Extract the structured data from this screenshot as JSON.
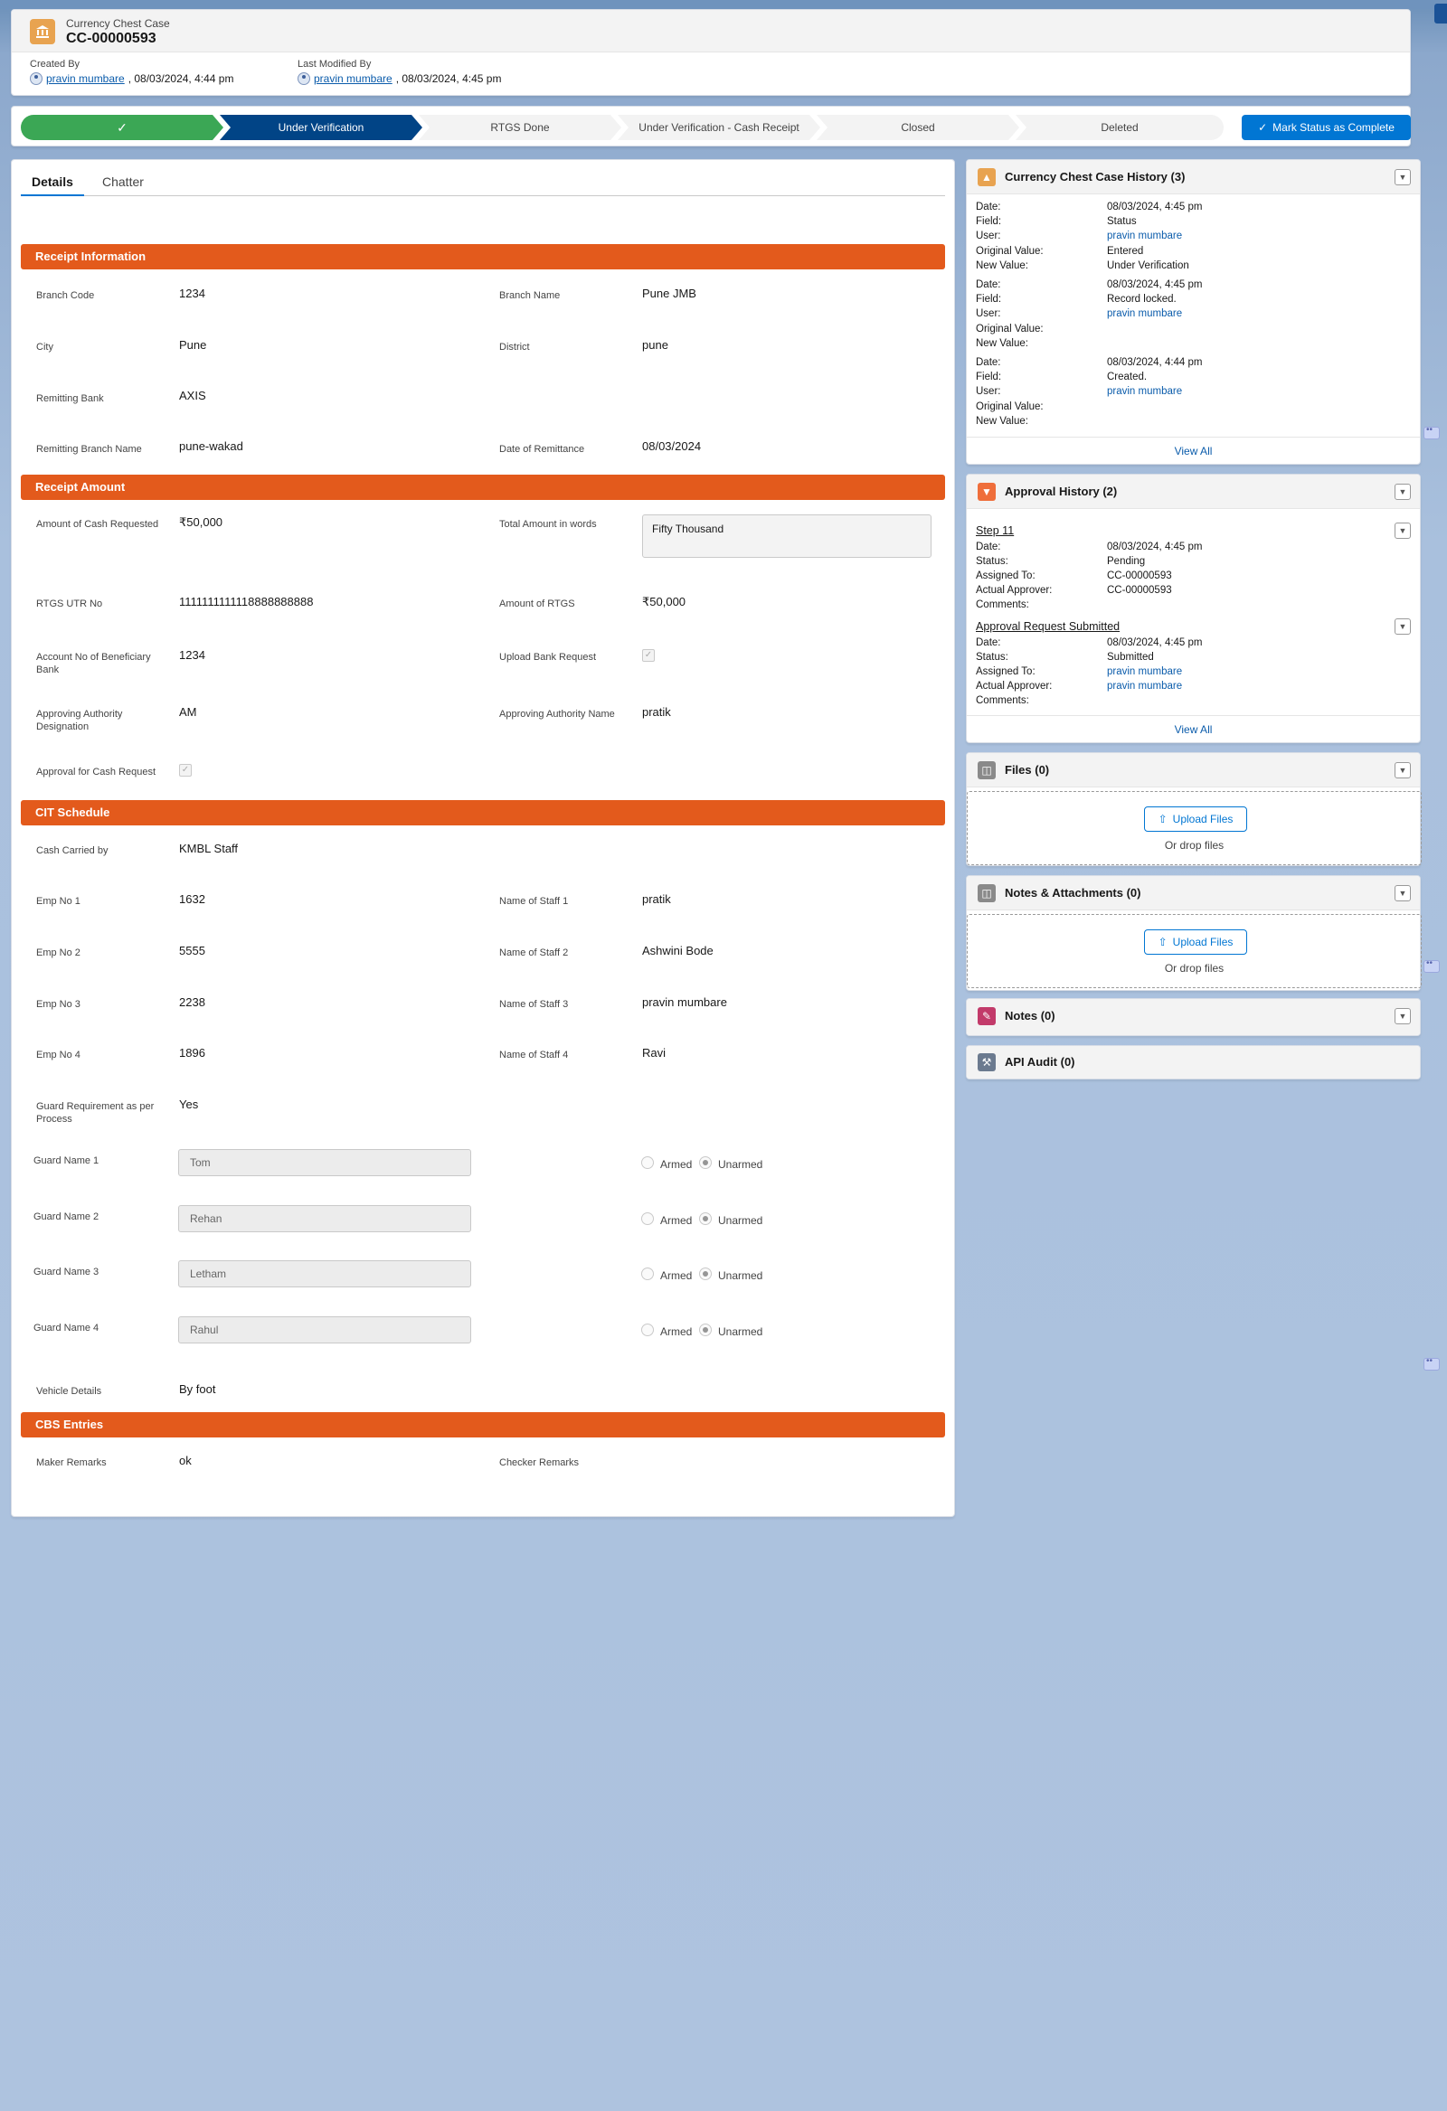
{
  "header": {
    "object_label": "Currency Chest Case",
    "record_name": "CC-00000593",
    "created_by_label": "Created By",
    "created_by_user": "pravin mumbare",
    "created_by_date": ", 08/03/2024, 4:44 pm",
    "modified_by_label": "Last Modified By",
    "modified_by_user": "pravin mumbare",
    "modified_by_date": ", 08/03/2024, 4:45 pm"
  },
  "path": {
    "stages": [
      "Under Verification",
      "RTGS Done",
      "Under Verification - Cash Receipt",
      "Closed",
      "Deleted"
    ],
    "mark_button": "Mark Status as Complete"
  },
  "tabs": [
    "Details",
    "Chatter"
  ],
  "receipt_info": {
    "title": "Receipt Information",
    "branch_code_label": "Branch Code",
    "branch_code": "1234",
    "branch_name_label": "Branch Name",
    "branch_name": "Pune JMB",
    "city_label": "City",
    "city": "Pune",
    "district_label": "District",
    "district": "pune",
    "remitting_bank_label": "Remitting Bank",
    "remitting_bank": "AXIS",
    "remitting_branch_label": "Remitting Branch Name",
    "remitting_branch": "pune-wakad",
    "date_remittance_label": "Date of Remittance",
    "date_remittance": "08/03/2024"
  },
  "receipt_amount": {
    "title": "Receipt Amount",
    "cash_requested_label": "Amount of Cash Requested",
    "cash_requested": "₹50,000",
    "total_words_label": "Total Amount in words",
    "total_words": "Fifty  Thousand",
    "utr_label": "RTGS UTR No",
    "utr": "1111111111118888888888",
    "rtgs_amount_label": "Amount of RTGS",
    "rtgs_amount": "₹50,000",
    "account_label": "Account No of Beneficiary Bank",
    "account": "1234",
    "upload_label": "Upload Bank Request",
    "auth_desig_label": "Approving Authority Designation",
    "auth_desig": "AM",
    "auth_name_label": "Approving Authority Name",
    "auth_name": "pratik",
    "approval_label": "Approval for Cash Request"
  },
  "cit": {
    "title": "CIT Schedule",
    "cash_carried_label": "Cash Carried by",
    "cash_carried": "KMBL Staff",
    "emp": [
      {
        "emp_label": "Emp No 1",
        "emp": "1632",
        "name_label": "Name of Staff 1",
        "name": "pratik"
      },
      {
        "emp_label": "Emp No 2",
        "emp": "5555",
        "name_label": "Name of Staff 2",
        "name": "Ashwini Bode"
      },
      {
        "emp_label": "Emp No 3",
        "emp": "2238",
        "name_label": "Name of Staff 3",
        "name": "pravin mumbare"
      },
      {
        "emp_label": "Emp No 4",
        "emp": "1896",
        "name_label": "Name of Staff 4",
        "name": "Ravi"
      }
    ],
    "guard_req_label": "Guard Requirement as per Process",
    "guard_req": "Yes",
    "guards": [
      {
        "label": "Guard Name 1",
        "value": "Tom"
      },
      {
        "label": "Guard Name 2",
        "value": "Rehan"
      },
      {
        "label": "Guard Name 3",
        "value": "Letham"
      },
      {
        "label": "Guard Name 4",
        "value": "Rahul"
      }
    ],
    "armed_label": "Armed",
    "unarmed_label": "Unarmed",
    "vehicle_label": "Vehicle Details",
    "vehicle": "By foot"
  },
  "cbs": {
    "title": "CBS Entries",
    "maker_label": "Maker Remarks",
    "maker": "ok",
    "checker_label": "Checker Remarks"
  },
  "history": {
    "title": "Currency Chest Case History (3)",
    "labels": {
      "date": "Date:",
      "field": "Field:",
      "user": "User:",
      "orig": "Original Value:",
      "new": "New Value:"
    },
    "entries": [
      {
        "date": "08/03/2024, 4:45 pm",
        "field": "Status",
        "user": "pravin mumbare",
        "orig": "Entered",
        "new": "Under Verification"
      },
      {
        "date": "08/03/2024, 4:45 pm",
        "field": "Record locked.",
        "user": "pravin mumbare",
        "orig": "",
        "new": ""
      },
      {
        "date": "08/03/2024, 4:44 pm",
        "field": "Created.",
        "user": "pravin mumbare",
        "orig": "",
        "new": ""
      }
    ],
    "view_all": "View All"
  },
  "approval": {
    "title": "Approval History (2)",
    "labels": {
      "date": "Date:",
      "status": "Status:",
      "assigned": "Assigned To:",
      "actual": "Actual Approver:",
      "comments": "Comments:"
    },
    "steps": [
      {
        "name": "Step 11",
        "date": "08/03/2024, 4:45 pm",
        "status": "Pending",
        "assigned": "CC-00000593",
        "actual": "CC-00000593"
      },
      {
        "name": "Approval Request Submitted",
        "date": "08/03/2024, 4:45 pm",
        "status": "Submitted",
        "assigned": "pravin mumbare",
        "actual": "pravin mumbare"
      }
    ],
    "view_all": "View All"
  },
  "files": {
    "title": "Files (0)",
    "upload": "Upload Files",
    "drop": "Or drop files"
  },
  "notes_att": {
    "title": "Notes & Attachments (0)",
    "upload": "Upload Files",
    "drop": "Or drop files"
  },
  "notes": {
    "title": "Notes (0)"
  },
  "api_audit": {
    "title": "API Audit (0)"
  },
  "colors": {
    "accent": "#0176d3",
    "section": "#e35a1c",
    "path_done": "#3ba755",
    "path_current": "#014486"
  }
}
